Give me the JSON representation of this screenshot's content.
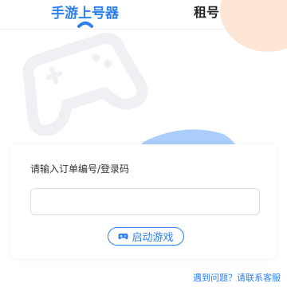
{
  "tabs": [
    {
      "label": "手游上号器",
      "active": true
    },
    {
      "label": "租号",
      "active": false
    }
  ],
  "form": {
    "label": "请输入订单编号/登录码",
    "input_value": "",
    "input_placeholder": ""
  },
  "launch_button": {
    "label": "启动游戏",
    "icon": "gamepad-icon"
  },
  "help_link": "遇到问题？请联系客服",
  "colors": {
    "accent": "#2b7ff0",
    "deco_orange": "#fde3cf",
    "deco_blue": "#9cc4fa",
    "deco_gray": "#eef0f3"
  }
}
